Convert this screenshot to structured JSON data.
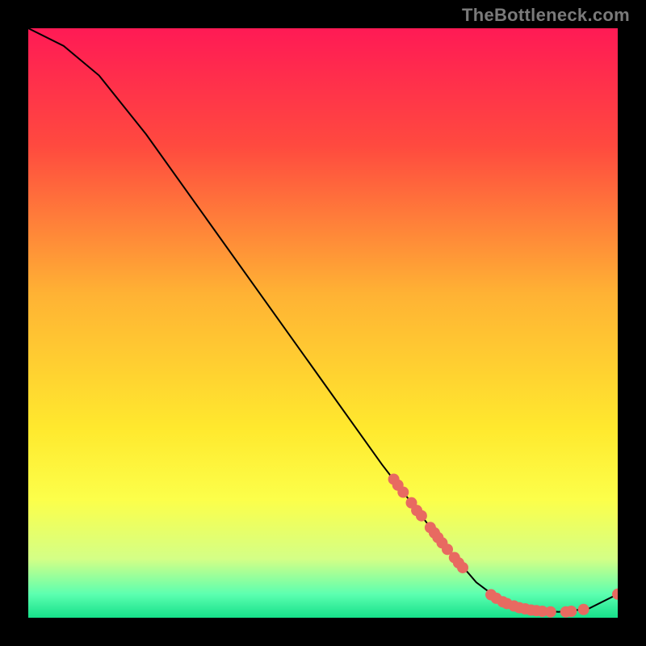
{
  "watermark": "TheBottleneck.com",
  "chart_data": {
    "type": "line",
    "title": "",
    "xlabel": "",
    "ylabel": "",
    "xlim": [
      0,
      100
    ],
    "ylim": [
      0,
      100
    ],
    "grid": false,
    "legend": false,
    "background_gradient_stops": [
      {
        "offset": 0,
        "color": "#ff1a55"
      },
      {
        "offset": 20,
        "color": "#ff4a3f"
      },
      {
        "offset": 45,
        "color": "#ffb234"
      },
      {
        "offset": 68,
        "color": "#ffe92e"
      },
      {
        "offset": 80,
        "color": "#fcff4a"
      },
      {
        "offset": 90,
        "color": "#d4ff86"
      },
      {
        "offset": 96,
        "color": "#5cffb0"
      },
      {
        "offset": 100,
        "color": "#16e08a"
      }
    ],
    "curve": [
      {
        "x": 0,
        "y": 100
      },
      {
        "x": 6,
        "y": 97
      },
      {
        "x": 12,
        "y": 92
      },
      {
        "x": 20,
        "y": 82
      },
      {
        "x": 30,
        "y": 68
      },
      {
        "x": 40,
        "y": 54
      },
      {
        "x": 50,
        "y": 40
      },
      {
        "x": 60,
        "y": 26
      },
      {
        "x": 70,
        "y": 13
      },
      {
        "x": 76,
        "y": 6
      },
      {
        "x": 80,
        "y": 3
      },
      {
        "x": 85,
        "y": 1.3
      },
      {
        "x": 90,
        "y": 1.0
      },
      {
        "x": 95,
        "y": 1.5
      },
      {
        "x": 100,
        "y": 4
      }
    ],
    "points": [
      {
        "x": 62,
        "y": 23.5
      },
      {
        "x": 62.7,
        "y": 22.5
      },
      {
        "x": 63.6,
        "y": 21.3
      },
      {
        "x": 65,
        "y": 19.5
      },
      {
        "x": 65.9,
        "y": 18.2
      },
      {
        "x": 66.7,
        "y": 17.3
      },
      {
        "x": 68.2,
        "y": 15.3
      },
      {
        "x": 68.9,
        "y": 14.4
      },
      {
        "x": 69.5,
        "y": 13.6
      },
      {
        "x": 70.2,
        "y": 12.7
      },
      {
        "x": 71.1,
        "y": 11.6
      },
      {
        "x": 72.3,
        "y": 10.2
      },
      {
        "x": 73.0,
        "y": 9.3
      },
      {
        "x": 73.7,
        "y": 8.5
      },
      {
        "x": 78.5,
        "y": 3.9
      },
      {
        "x": 79.4,
        "y": 3.3
      },
      {
        "x": 80.5,
        "y": 2.7
      },
      {
        "x": 81.2,
        "y": 2.4
      },
      {
        "x": 82.4,
        "y": 2.0
      },
      {
        "x": 83.3,
        "y": 1.7
      },
      {
        "x": 84.3,
        "y": 1.5
      },
      {
        "x": 85.3,
        "y": 1.3
      },
      {
        "x": 86.2,
        "y": 1.2
      },
      {
        "x": 87.2,
        "y": 1.1
      },
      {
        "x": 88.6,
        "y": 1.0
      },
      {
        "x": 91.2,
        "y": 1.0
      },
      {
        "x": 92.1,
        "y": 1.1
      },
      {
        "x": 94.2,
        "y": 1.4
      },
      {
        "x": 100,
        "y": 4.0
      }
    ],
    "point_color": "#e86a61",
    "curve_color": "#000000"
  }
}
